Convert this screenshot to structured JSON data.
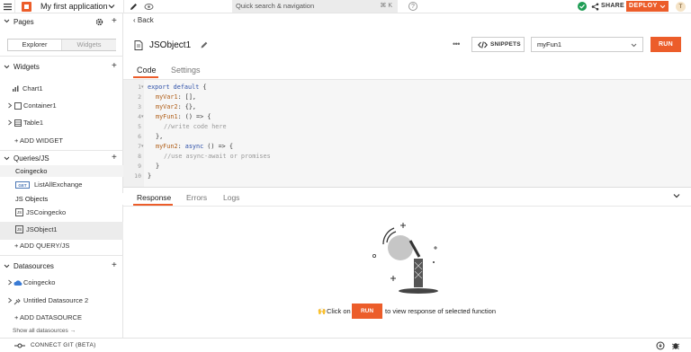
{
  "topbar": {
    "app_name": "My first application",
    "search_placeholder": "Quick search & navigation",
    "search_shortcut": "⌘ K",
    "help_label": "?",
    "share_label": "SHARE",
    "deploy_label": "DEPLOY",
    "avatar_initial": "T"
  },
  "sidebar": {
    "pages_label": "Pages",
    "explorer_tab": "Explorer",
    "widgets_tab": "Widgets",
    "widgets_label": "Widgets",
    "widgets": [
      "Chart1",
      "Container1",
      "Table1"
    ],
    "add_widget": "+ ADD WIDGET",
    "queries_label": "Queries/JS",
    "coingecko_group": "Coingecko",
    "get_badge": "GET",
    "list_all_exchange": "ListAllExchange",
    "js_objects_group": "JS Objects",
    "js_badge": "JS",
    "js_items": [
      "JSCoingecko",
      "JSObject1"
    ],
    "add_query": "+ ADD QUERY/JS",
    "datasources_label": "Datasources",
    "datasources": [
      "Coingecko",
      "Untitled Datasource 2"
    ],
    "add_datasource": "+ ADD DATASOURCE",
    "show_all": "Show all datasources  →"
  },
  "bottombar": {
    "connect_git": "CONNECT GIT (BETA)"
  },
  "editor": {
    "back_label": "Back",
    "object_name": "JSObject1",
    "more_label": "•••",
    "snippets_label": "SNIPPETS",
    "function_selected": "myFun1",
    "run_label": "RUN",
    "tabs": [
      "Code",
      "Settings"
    ],
    "line_numbers": [
      "1",
      "2",
      "3",
      "4",
      "5",
      "6",
      "7",
      "8",
      "9",
      "10"
    ],
    "code": {
      "l1_kw": "export default",
      "l1_rest": " {",
      "l2_prop": "myVar1",
      "l2_rest": ": [],",
      "l3_prop": "myVar2",
      "l3_rest": ": {},",
      "l4_prop": "myFun1",
      "l4_rest": ": () => {",
      "l5_comment": "//write code here",
      "l6": "},",
      "l7_prop": "myFun2",
      "l7_mid": ": ",
      "l7_kw": "async",
      "l7_rest": " () => {",
      "l8_comment": "//use async-await or promises",
      "l9": "}",
      "l10": "}"
    }
  },
  "response": {
    "tabs": [
      "Response",
      "Errors",
      "Logs"
    ],
    "hint_prefix": "Click on",
    "hint_button": "RUN",
    "hint_suffix": "to view response of selected function"
  },
  "colors": {
    "accent": "#ec5d2a",
    "success": "#1f9d55",
    "keyword": "#2c4fa8",
    "property": "#b05d16"
  }
}
